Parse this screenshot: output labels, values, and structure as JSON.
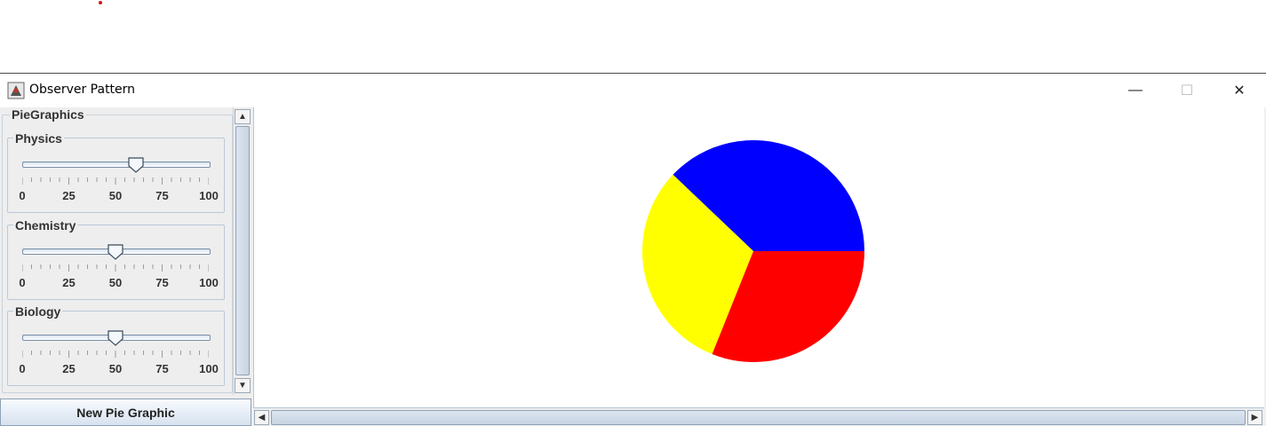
{
  "window": {
    "title": "Observer Pattern",
    "minimize_glyph": "—",
    "maximize_glyph": "☐",
    "close_glyph": "✕"
  },
  "panel": {
    "title": "PieGraphics",
    "sliders": [
      {
        "label": "Physics",
        "value": 61,
        "min": 0,
        "max": 100,
        "tick_labels": [
          "0",
          "25",
          "50",
          "75",
          "100"
        ]
      },
      {
        "label": "Chemistry",
        "value": 50,
        "min": 0,
        "max": 100,
        "tick_labels": [
          "0",
          "25",
          "50",
          "75",
          "100"
        ]
      },
      {
        "label": "Biology",
        "value": 50,
        "min": 0,
        "max": 100,
        "tick_labels": [
          "0",
          "25",
          "50",
          "75",
          "100"
        ]
      }
    ],
    "button_label": "New Pie Graphic"
  },
  "chart_data": {
    "type": "pie",
    "slices": [
      {
        "label": "Physics",
        "value": 61,
        "color": "#0000ff"
      },
      {
        "label": "Chemistry",
        "value": 50,
        "color": "#ffff00"
      },
      {
        "label": "Biology",
        "value": 50,
        "color": "#ff0000"
      }
    ]
  },
  "icons": {
    "app": "java-app-icon",
    "scroll_up": "arrow-up-icon",
    "scroll_down": "arrow-down-icon",
    "scroll_left": "arrow-left-icon",
    "scroll_right": "arrow-right-icon"
  }
}
